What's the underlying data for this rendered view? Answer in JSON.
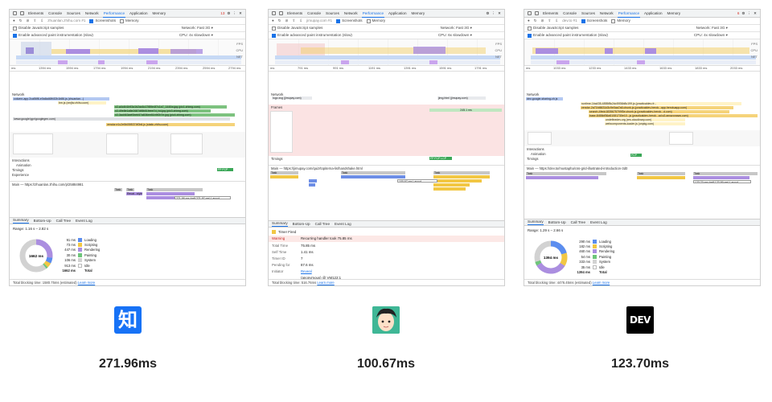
{
  "devtools_tabs": [
    "Elements",
    "Console",
    "Sources",
    "Network",
    "Performance",
    "Application",
    "Memory"
  ],
  "panels": [
    {
      "id": "zhihu",
      "badge": "13",
      "url": "zhuanlan.zhihu.com #1",
      "network": "Fast 3G",
      "cpu": "4x slowdown",
      "disable_js": "Disable JavaScript samples",
      "advanced": "Enable advanced paint instrumentation (slow)",
      "screenshots": "Screenshots",
      "memory": "Memory",
      "ruler": [
        "ms",
        "1394 ms",
        "1594 ms",
        "1794 ms",
        "1994 ms",
        "2194 ms",
        "2394 ms",
        "2594 ms",
        "2794 ms"
      ],
      "main_ticks": [
        "ms",
        "1394 ms",
        "1594 ms",
        "1794 ms",
        "1994 ms",
        "2194 ms",
        "2394 ms",
        "2594 ms"
      ],
      "network_label": "Network",
      "net_items": [
        "column-app.2ca56f6-e0a6a46fb32b1b86.js (zhuanlan...)",
        "bm.js (xmjfw.zhihu.com)",
        "v2-a4c4b1b93a1b2ac6c17f89e4f7c1a7_1440w.jpg (pic1.zhimg.com)",
        "v2-49e8e1a8e2687df8b51feee7d_hd.jpg (pic3.zhimg.com)",
        "v2-3ad463aef0beb57a836ee81b9f2b7e.jpg (pic4.zhimg.com)",
        "/www.google/gpr/googlegen.com)",
        "vendor.e1c2e5b05f5374f0b6.js (static.zhihu.com)"
      ],
      "interactions": "Interactions",
      "animation": "Animation",
      "timings": "Timings",
      "experience": "Experience",
      "fcp": "FP FCP",
      "main_label": "Main — https://zhuanlan.zhihu.com/p/25884981",
      "task_bars": [
        "Task",
        "Task",
        "Recal...style",
        "Task"
      ],
      "tooltip": "271.96 ms (self 271.97 ms) Layout",
      "range": "Range: 1.16 s – 2.82 s",
      "total_center": "1662 ms",
      "legend": [
        {
          "v": "91 ms",
          "n": "Loading",
          "c": "#5b8def"
        },
        {
          "v": "73 ms",
          "n": "Scripting",
          "c": "#f2c744"
        },
        {
          "v": "447 ms",
          "n": "Rendering",
          "c": "#ab8ee0"
        },
        {
          "v": "30 ms",
          "n": "Painting",
          "c": "#6ec57a"
        },
        {
          "v": "106 ms",
          "n": "System",
          "c": "#d2d2d2"
        },
        {
          "v": "913 ms",
          "n": "Idle",
          "c": "#ffffff"
        },
        {
          "v": "1662 ms",
          "n": "Total",
          "c": "none"
        }
      ],
      "footer": "Total blocking time: 1580.75ms (estimated)",
      "learn": "Learn more",
      "sum_tabs": [
        "Summary",
        "Bottom-Up",
        "Call Tree",
        "Event Log"
      ]
    },
    {
      "id": "jimu",
      "badge": "",
      "url": "jimupay.com #1",
      "network": "Fast 3G",
      "cpu": "6x slowdown",
      "disable_js": "Disable JavaScript samples",
      "advanced": "Enable advanced paint instrumentation (slow)",
      "screenshots": "Screenshots",
      "memory": "Memory",
      "ruler": [
        "ms",
        "791 ms",
        "991 ms",
        "1191 ms",
        "1391 ms",
        "1591 ms",
        "1791 ms"
      ],
      "main_ticks": [
        "ms",
        "791 ms",
        "891 ms",
        "991 ms",
        "1091 ms",
        "1191 ms",
        "1291 ms",
        "1391 ms",
        "1491 ms"
      ],
      "network_label": "Network",
      "net_items": [
        "logo.svg (jimupay.com)",
        "jimg.html (jimupay.com)"
      ],
      "frames": "Frames",
      "frame_time": "245.1 ms",
      "timings": "Timings",
      "fcp": "FP FCP LCP",
      "main_label": "Main — https://jimupay.com/quiz/topiterna-lis/handshake.html",
      "task_bars": [
        "Task",
        "Task",
        "Task",
        "Task"
      ],
      "tooltip": "100.67 ms Layout",
      "timer": "Timer Fired",
      "warning_lbl": "Warning",
      "warning": "Recurring handler took 75.85 ms",
      "rows": [
        {
          "k": "Total Time",
          "v": "75.85 ms"
        },
        {
          "k": "Self Time",
          "v": "1.41 ms"
        },
        {
          "k": "Timer ID",
          "v": "7"
        },
        {
          "k": "Pending for",
          "v": "87.6 ms"
        },
        {
          "k": "Initiator",
          "v": "Reveal"
        }
      ],
      "stack": "(anonymous) @ VM122:1",
      "footer": "Total blocking time: 516.76ms",
      "learn": "Learn more",
      "sum_tabs": [
        "Summary",
        "Bottom-Up",
        "Call Tree",
        "Event Log"
      ]
    },
    {
      "id": "dev",
      "badge": "6",
      "url": "dev.to #1",
      "network": "Fast 3G",
      "cpu": "4x slowdown",
      "disable_js": "Disable JavaScript samples",
      "advanced": "Enable advanced paint instrumentation (slow)",
      "screenshots": "Screenshots",
      "memory": "Memory",
      "ruler": [
        "ms",
        "1033 ms",
        "1233 ms",
        "1433 ms",
        "1633 ms",
        "1833 ms",
        "2033 ms"
      ],
      "main_ticks": [
        "ms",
        "833 ms",
        "1033 ms",
        "1233 ms",
        "1433 ms",
        "1633 ms",
        "1833 ms",
        "2033 ms"
      ],
      "network_label": "Network",
      "net_items": [
        "dev-google-sharing-ch.js",
        "runtime-1ba435-4855f8c2dc5936b8c199.js (practicaldev-fr...",
        "vendor-2a71fd6631d3c9e0aa7a6.chunk.js (practicaldev-herok...app.herokuapp.com)",
        "search-4fedc1835675799f3e.chunk.js (practicaldev-herok...d.com)",
        "base-8458df36a51081730e10...js (practicaldev-herok...ad.s3.amazonaws.com)",
        "undefinedev.org (res.cloudinary.com)",
        "webcomponents-loader.js (unpkg.com)"
      ],
      "interactions": "Interactions",
      "animation": "Animation",
      "timings": "Timings",
      "fcp": "FCP",
      "main_label": "Main — https://dev.to/mustapha/css-grid-illustrated-introduction-3d0",
      "task_bars": [
        "Task",
        "Task",
        "Task"
      ],
      "tooltip": "123.70 ms (self 123.69 ms) Layout",
      "range": "Range: 1.29 s – 2.66 s",
      "total_center": "1394 ms",
      "legend": [
        {
          "v": "290 ms",
          "n": "Loading",
          "c": "#5b8def"
        },
        {
          "v": "182 ms",
          "n": "Scripting",
          "c": "#f2c744"
        },
        {
          "v": "460 ms",
          "n": "Rendering",
          "c": "#ab8ee0"
        },
        {
          "v": "54 ms",
          "n": "Painting",
          "c": "#6ec57a"
        },
        {
          "v": "333 ms",
          "n": "System",
          "c": "#d2d2d2"
        },
        {
          "v": "35 ms",
          "n": "Idle",
          "c": "#ffffff"
        },
        {
          "v": "1394 ms",
          "n": "Total",
          "c": "none"
        }
      ],
      "footer": "Total blocking time: 4476.45ms (estimated)",
      "learn": "Learn more",
      "sum_tabs": [
        "Summary",
        "Bottom-Up",
        "Call Tree",
        "Event Log"
      ]
    }
  ],
  "logos": {
    "zhihu": "知",
    "dev": "DEV"
  },
  "times": [
    "271.96ms",
    "100.67ms",
    "123.70ms"
  ]
}
